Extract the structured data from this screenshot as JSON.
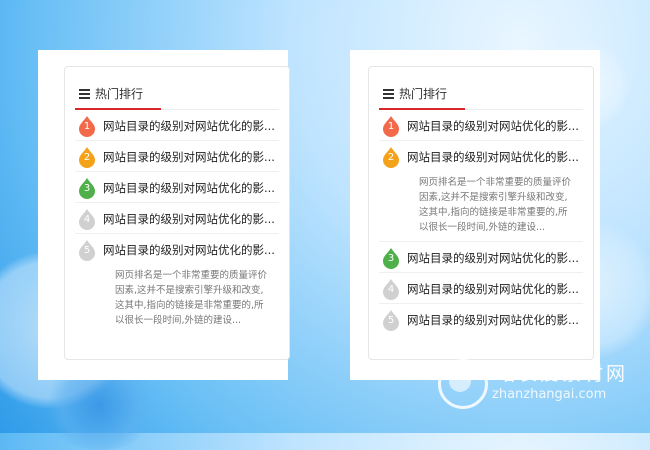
{
  "colors": {
    "accent_red": "#d8262b",
    "rank1": "#f26a4b",
    "rank2": "#f5a21b",
    "rank3": "#4fb04a",
    "rank_other": "#d0d0d0"
  },
  "left_panel": {
    "title": "热门排行",
    "items": [
      {
        "rank": "1",
        "text": "网站目录的级别对网站优化的影..."
      },
      {
        "rank": "2",
        "text": "网站目录的级别对网站优化的影..."
      },
      {
        "rank": "3",
        "text": "网站目录的级别对网站优化的影..."
      },
      {
        "rank": "4",
        "text": "网站目录的级别对网站优化的影..."
      },
      {
        "rank": "5",
        "text": "网站目录的级别对网站优化的影..."
      }
    ],
    "expanded_desc": "网页排名是一个非常重要的质量评价因素,这并不是搜索引擎升级和改变,这其中,指向的链接是非常重要的,所以很长一段时间,外链的建设..."
  },
  "right_panel": {
    "title": "热门排行",
    "items": [
      {
        "rank": "1",
        "text": "网站目录的级别对网站优化的影..."
      },
      {
        "rank": "2",
        "text": "网站目录的级别对网站优化的影..."
      },
      {
        "rank": "3",
        "text": "网站目录的级别对网站优化的影..."
      },
      {
        "rank": "4",
        "text": "网站目录的级别对网站优化的影..."
      },
      {
        "rank": "5",
        "text": "网站目录的级别对网站优化的影..."
      }
    ],
    "expanded_desc": "网页排名是一个非常重要的质量评价因素,这并不是搜索引擎升级和改变,这其中,指向的链接是非常重要的,所以很长一段时间,外链的建设..."
  },
  "watermark": {
    "cn": "站长爱素材网",
    "en": "zhanzhangai.com"
  }
}
